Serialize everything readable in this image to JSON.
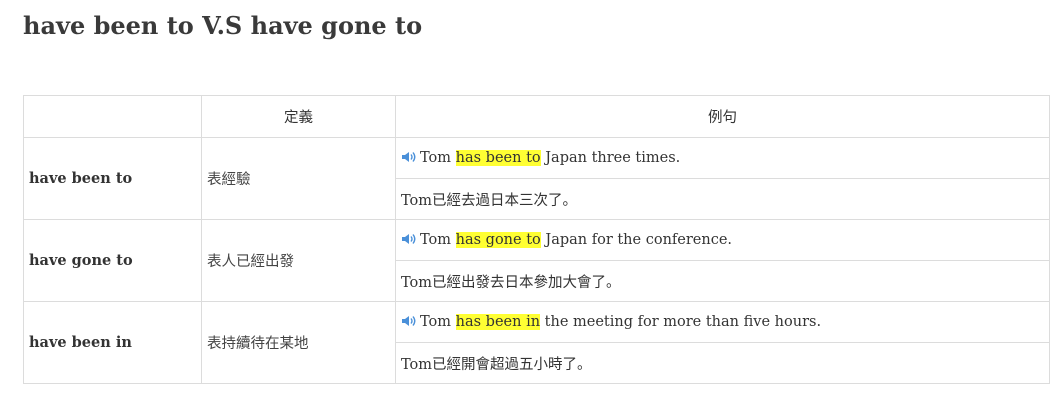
{
  "title": "have been to V.S have gone to",
  "table": {
    "headers": [
      "",
      "定義",
      "例句"
    ],
    "rows": [
      {
        "term": "have been to",
        "definition": "表經驗",
        "example_pre": "Tom ",
        "example_highlight": "has been to",
        "example_post": " Japan three times.",
        "translation": "Tom已經去過日本三次了。"
      },
      {
        "term": "have gone to",
        "definition": "表人已經出發",
        "example_pre": "Tom ",
        "example_highlight": "has gone to",
        "example_post": " Japan for the conference.",
        "translation": "Tom已經出發去日本參加大會了。"
      },
      {
        "term": "have been in",
        "definition": "表持續待在某地",
        "example_pre": "Tom ",
        "example_highlight": "has been in",
        "example_post": " the meeting for more than five hours.",
        "translation": "Tom已經開會超過五小時了。"
      }
    ]
  },
  "icons": {
    "audio": "speaker-icon"
  },
  "colors": {
    "highlight": "#ffff33",
    "icon": "#4a90d9",
    "border": "#dcdcdc"
  }
}
